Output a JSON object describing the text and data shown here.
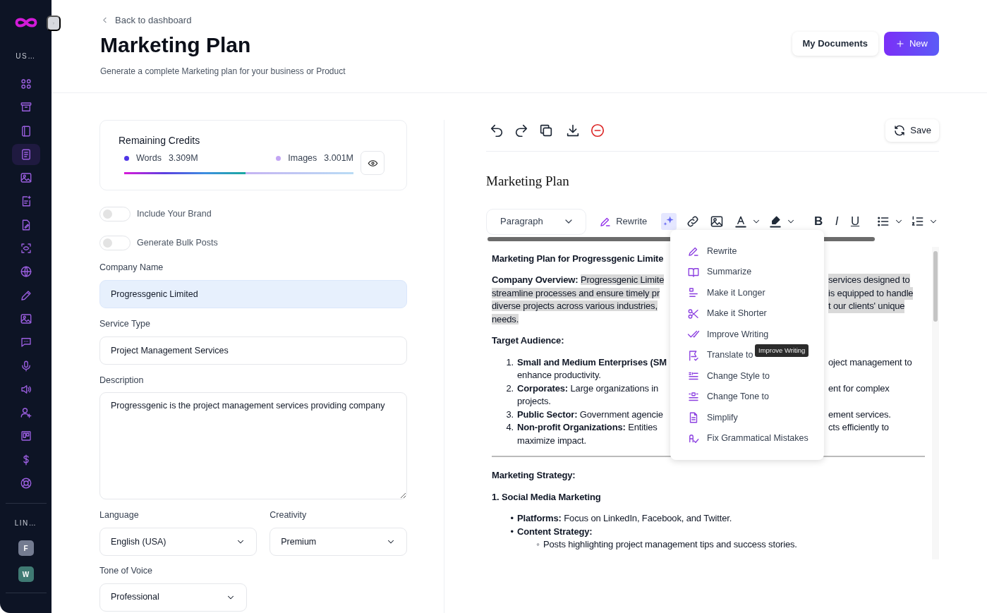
{
  "sidebar": {
    "section_label": "US…",
    "items": [
      {
        "selected": false
      },
      {
        "selected": false
      },
      {
        "selected": false
      },
      {
        "selected": true
      },
      {
        "selected": false
      },
      {
        "selected": false
      },
      {
        "selected": false
      },
      {
        "selected": false
      },
      {
        "selected": false
      },
      {
        "selected": false
      },
      {
        "selected": false
      },
      {
        "selected": false
      },
      {
        "selected": false
      },
      {
        "selected": false
      },
      {
        "selected": false
      },
      {
        "selected": false
      },
      {
        "selected": false
      },
      {
        "selected": false
      }
    ],
    "links_label": "LIN…",
    "links": [
      {
        "initial": "F",
        "color": "#737b90"
      },
      {
        "initial": "W",
        "color": "#3f7a73"
      }
    ]
  },
  "header": {
    "back": "Back to dashboard",
    "title": "Marketing Plan",
    "subtitle": "Generate a complete Marketing plan for your business or Product",
    "buttons": [
      {
        "label": "My Documents",
        "kind": "secondary"
      },
      {
        "label": "New",
        "kind": "primary"
      }
    ]
  },
  "credits": {
    "title": "Remaining Credits",
    "words_label": "Words",
    "words": "3.309M",
    "images_label": "Images",
    "images": "3.001M",
    "level": 0.53
  },
  "toggles": [
    {
      "label": "Include Your Brand",
      "on": false
    },
    {
      "label": "Generate Bulk Posts",
      "on": false
    }
  ],
  "fields": {
    "company_label": "Company Name",
    "company": "Progressgenic Limited",
    "service_label": "Service Type",
    "service": "Project Management Services",
    "description_label": "Description",
    "description": "Progressgenic is the project management services providing company",
    "language_label": "Language",
    "language": "English (USA)",
    "creativity_label": "Creativity",
    "creativity": "Premium",
    "tone_label": "Tone of Voice",
    "tone": "Professional"
  },
  "editor": {
    "save": "Save",
    "doc_title": "Marketing Plan",
    "block_type": "Paragraph",
    "rewrite": "Rewrite",
    "tools": [
      {
        "kind": "icon",
        "selected": true
      },
      {
        "kind": "icon",
        "selected": false
      },
      {
        "kind": "icon",
        "selected": false
      },
      {
        "kind": "icon",
        "selected": false
      },
      {
        "kind": "icon",
        "selected": false
      },
      {
        "kind": "char",
        "label": "B",
        "selected": false
      },
      {
        "kind": "char",
        "label": "I",
        "selected": false
      },
      {
        "kind": "char",
        "label": "U",
        "selected": false
      },
      {
        "kind": "icon",
        "selected": false
      },
      {
        "kind": "icon",
        "selected": false
      }
    ],
    "lines": [
      {
        "kind": "title",
        "lead": "Marketing Plan for Progressgenic Limite",
        "highlighted": false
      },
      {
        "kind": "para",
        "lead": "Company Overview:",
        "text": "Progressgenic Limite",
        "right": "services designed to",
        "highlighted": true
      },
      {
        "kind": "para",
        "text": "streamline processes and ensure timely pr",
        "right": "is equipped to handle",
        "highlighted": true
      },
      {
        "kind": "para",
        "text": "diverse projects across various industries,",
        "right": "t our clients' unique",
        "highlighted": true
      },
      {
        "kind": "para",
        "text": "needs.",
        "highlighted": true
      },
      {
        "kind": "heading",
        "lead": "Target Audience:",
        "highlighted": false
      },
      {
        "kind": "ol",
        "marker": "1.",
        "lead": "Small and Medium Enterprises (SM",
        "right": "oject management to",
        "highlighted": false
      },
      {
        "kind": "ol",
        "text": "enhance productivity.",
        "highlighted": false
      },
      {
        "kind": "ol",
        "marker": "2.",
        "lead": "Corporates:",
        "text": "Large organizations in",
        "right": "ent for complex",
        "highlighted": false
      },
      {
        "kind": "ol",
        "text": "projects.",
        "highlighted": false
      },
      {
        "kind": "ol",
        "marker": "3.",
        "lead": "Public Sector:",
        "text": "Government agencie",
        "right": "ement services.",
        "highlighted": false
      },
      {
        "kind": "ol",
        "marker": "4.",
        "lead": "Non-profit Organizations:",
        "text": "Entities",
        "right": "cts efficiently to",
        "highlighted": false
      },
      {
        "kind": "ol",
        "text": "maximize impact.",
        "highlighted": false
      },
      {
        "kind": "rule"
      },
      {
        "kind": "heading",
        "lead": "Marketing Strategy:",
        "highlighted": false
      },
      {
        "kind": "heading",
        "lead": "1. Social Media Marketing",
        "highlighted": false
      },
      {
        "kind": "ul",
        "marker": "•",
        "lead": "Platforms:",
        "text": "Focus on LinkedIn, Facebook, and Twitter.",
        "highlighted": false
      },
      {
        "kind": "ul",
        "marker": "•",
        "lead": "Content Strategy:",
        "highlighted": false
      },
      {
        "kind": "sub",
        "marker": "◦",
        "text": "Posts highlighting project management tips and success stories.",
        "highlighted": false
      }
    ],
    "menu": [
      {
        "label": "Rewrite"
      },
      {
        "label": "Summarize"
      },
      {
        "label": "Make it Longer"
      },
      {
        "label": "Make it Shorter"
      },
      {
        "label": "Improve Writing"
      },
      {
        "label": "Translate to"
      },
      {
        "label": "Change Style to"
      },
      {
        "label": "Change Tone to"
      },
      {
        "label": "Simplify"
      },
      {
        "label": "Fix Grammatical Mistakes"
      }
    ],
    "tooltip": "Improve Writing"
  }
}
